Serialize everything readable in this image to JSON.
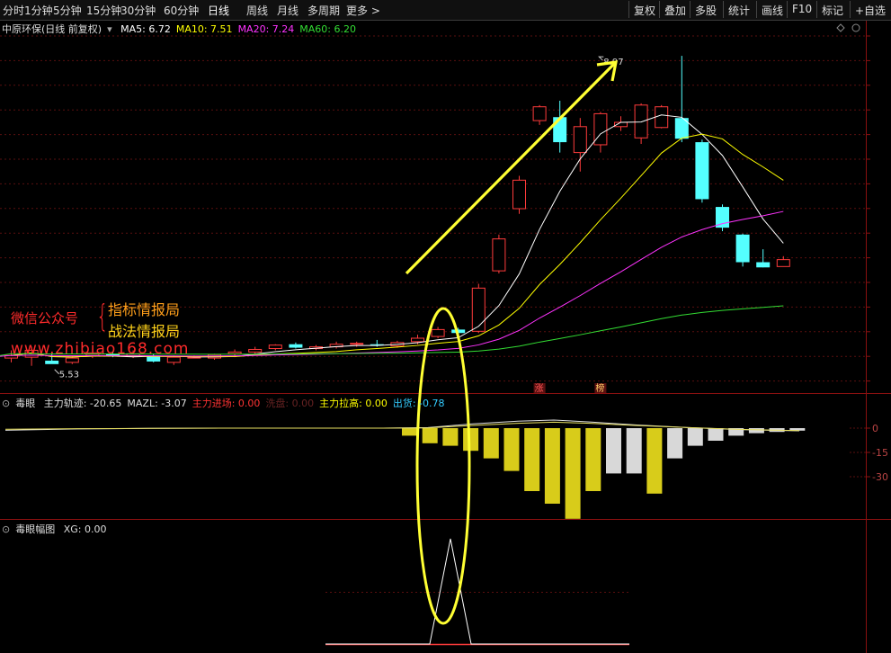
{
  "toolbar": {
    "left": [
      "分时",
      "1分钟",
      "5分钟",
      "15分钟",
      "30分钟",
      "60分钟",
      "日线",
      "周线",
      "月线",
      "多周期",
      "更多 >"
    ],
    "active": "日线",
    "right": [
      "复权",
      "叠加",
      "多股",
      "统计",
      "画线",
      "F10",
      "标记",
      "+自选"
    ]
  },
  "panel1": {
    "title": "中原环保(日线 前复权)",
    "ma_legend": [
      {
        "label": "MA5: 6.72",
        "color": "#ffffff"
      },
      {
        "label": "MA10: 7.51",
        "color": "#ffff00"
      },
      {
        "label": "MA20: 7.24",
        "color": "#ff33ff"
      },
      {
        "label": "MA60: 6.20",
        "color": "#33dd33"
      }
    ],
    "high_label": "8.97",
    "low_label": "5.53",
    "tags": [
      "涨",
      "榜"
    ],
    "watermark": {
      "line1": "微信公众号",
      "brace": "{",
      "line2a": "指标情报局",
      "line2b": "战法情报局",
      "url": "www.zhibiao168.com"
    }
  },
  "panel2": {
    "title": "毒眼",
    "legend": [
      {
        "label": "主力轨迹: -20.65",
        "color": "#dddddd"
      },
      {
        "label": "MAZL: -3.07",
        "color": "#dddddd"
      },
      {
        "label": "主力进场: 0.00",
        "color": "#ff3333"
      },
      {
        "label": "洗盘: 0.00",
        "color": "#662222"
      },
      {
        "label": "主力拉高: 0.00",
        "color": "#ffff00"
      },
      {
        "label": "出货: -0.78",
        "color": "#33ccff"
      }
    ],
    "axis": [
      "0",
      "-15",
      "-30"
    ]
  },
  "panel3": {
    "title": "毒眼幅图",
    "legend": [
      {
        "label": "XG: 0.00",
        "color": "#dddddd"
      }
    ]
  },
  "chart_data": [
    {
      "type": "candlestick",
      "title": "中原环保(日线 前复权)",
      "series": [
        {
          "name": "candles",
          "values": [
            {
              "o": 5.47,
              "h": 5.56,
              "l": 5.42,
              "c": 5.5
            },
            {
              "o": 5.48,
              "h": 5.6,
              "l": 5.38,
              "c": 5.56
            },
            {
              "o": 5.44,
              "h": 5.52,
              "l": 5.41,
              "c": 5.4
            },
            {
              "o": 5.42,
              "h": 5.5,
              "l": 5.4,
              "c": 5.47
            },
            {
              "o": 5.5,
              "h": 5.58,
              "l": 5.47,
              "c": 5.53
            },
            {
              "o": 5.52,
              "h": 5.55,
              "l": 5.48,
              "c": 5.5
            },
            {
              "o": 5.49,
              "h": 5.56,
              "l": 5.47,
              "c": 5.52
            },
            {
              "o": 5.5,
              "h": 5.52,
              "l": 5.42,
              "c": 5.43
            },
            {
              "o": 5.42,
              "h": 5.5,
              "l": 5.39,
              "c": 5.48
            },
            {
              "o": 5.48,
              "h": 5.5,
              "l": 5.47,
              "c": 5.48
            },
            {
              "o": 5.47,
              "h": 5.52,
              "l": 5.45,
              "c": 5.51
            },
            {
              "o": 5.52,
              "h": 5.57,
              "l": 5.48,
              "c": 5.54
            },
            {
              "o": 5.54,
              "h": 5.6,
              "l": 5.52,
              "c": 5.57
            },
            {
              "o": 5.58,
              "h": 5.63,
              "l": 5.56,
              "c": 5.62
            },
            {
              "o": 5.63,
              "h": 5.65,
              "l": 5.58,
              "c": 5.59
            },
            {
              "o": 5.58,
              "h": 5.62,
              "l": 5.56,
              "c": 5.6
            },
            {
              "o": 5.6,
              "h": 5.66,
              "l": 5.58,
              "c": 5.63
            },
            {
              "o": 5.63,
              "h": 5.66,
              "l": 5.6,
              "c": 5.64
            },
            {
              "o": 5.63,
              "h": 5.68,
              "l": 5.6,
              "c": 5.62
            },
            {
              "o": 5.61,
              "h": 5.67,
              "l": 5.59,
              "c": 5.65
            },
            {
              "o": 5.66,
              "h": 5.74,
              "l": 5.63,
              "c": 5.7
            },
            {
              "o": 5.72,
              "h": 5.83,
              "l": 5.7,
              "c": 5.8
            },
            {
              "o": 5.8,
              "h": 5.82,
              "l": 5.74,
              "c": 5.76
            },
            {
              "o": 5.78,
              "h": 6.33,
              "l": 5.76,
              "c": 6.28
            },
            {
              "o": 6.48,
              "h": 6.9,
              "l": 6.45,
              "c": 6.85
            },
            {
              "o": 7.2,
              "h": 7.58,
              "l": 7.14,
              "c": 7.53
            },
            {
              "o": 8.22,
              "h": 8.4,
              "l": 8.17,
              "c": 8.38
            },
            {
              "o": 8.26,
              "h": 8.45,
              "l": 7.85,
              "c": 7.97
            },
            {
              "o": 7.85,
              "h": 8.25,
              "l": 7.63,
              "c": 8.15
            },
            {
              "o": 7.94,
              "h": 8.32,
              "l": 7.85,
              "c": 8.3
            },
            {
              "o": 8.15,
              "h": 8.27,
              "l": 8.1,
              "c": 8.2
            },
            {
              "o": 8.02,
              "h": 8.42,
              "l": 7.95,
              "c": 8.4
            },
            {
              "o": 8.14,
              "h": 8.4,
              "l": 8.13,
              "c": 8.38
            },
            {
              "o": 8.25,
              "h": 8.97,
              "l": 7.97,
              "c": 8.01
            },
            {
              "o": 7.97,
              "h": 8.0,
              "l": 7.27,
              "c": 7.31
            },
            {
              "o": 7.22,
              "h": 7.25,
              "l": 6.94,
              "c": 6.98
            },
            {
              "o": 6.9,
              "h": 6.91,
              "l": 6.53,
              "c": 6.58
            },
            {
              "o": 6.58,
              "h": 6.73,
              "l": 6.52,
              "c": 6.52
            },
            {
              "o": 6.53,
              "h": 6.65,
              "l": 6.53,
              "c": 6.61
            }
          ]
        }
      ]
    },
    {
      "type": "bar",
      "title": "毒眼",
      "series": [
        {
          "name": "主力轨迹",
          "values": [
            -3,
            -6,
            -7,
            -9,
            -12,
            -17,
            -25,
            -30,
            -36,
            -25,
            -18,
            -18,
            -26,
            -12,
            -7,
            -5,
            -3,
            -2,
            -1.5,
            -1
          ]
        }
      ]
    },
    {
      "type": "line",
      "title": "毒眼幅图",
      "series": [
        {
          "name": "XG",
          "values": [
            0,
            0,
            1,
            0,
            0
          ]
        }
      ]
    }
  ]
}
